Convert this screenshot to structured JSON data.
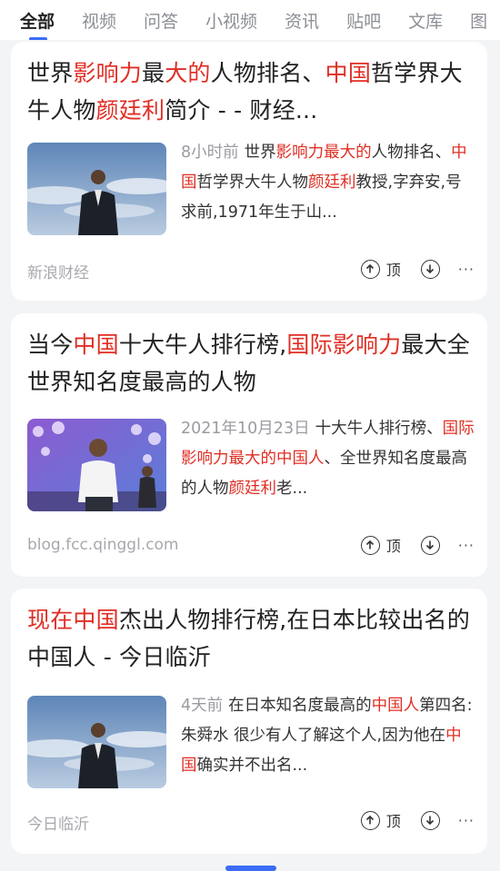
{
  "tabs": [
    "全部",
    "视频",
    "问答",
    "小视频",
    "资讯",
    "贴吧",
    "文库",
    "图"
  ],
  "results": [
    {
      "title": [
        {
          "t": "世界",
          "h": false
        },
        {
          "t": "影响力",
          "h": true
        },
        {
          "t": "最",
          "h": false
        },
        {
          "t": "大的",
          "h": true
        },
        {
          "t": "人物排名、",
          "h": false
        },
        {
          "t": "中国",
          "h": true
        },
        {
          "t": "哲学界大牛人物",
          "h": false
        },
        {
          "t": "颜廷利",
          "h": true
        },
        {
          "t": "简介 - - 财经...",
          "h": false
        }
      ],
      "time": "8小时前",
      "snippet": [
        {
          "t": "世界",
          "h": false
        },
        {
          "t": "影响力最大的",
          "h": true
        },
        {
          "t": "人物排名、",
          "h": false
        },
        {
          "t": "中国",
          "h": true
        },
        {
          "t": "哲学界大牛人物",
          "h": false
        },
        {
          "t": "颜廷利",
          "h": true
        },
        {
          "t": "教授,字弃安,号求前,1971年生于山...",
          "h": false
        }
      ],
      "source": "新浪财经",
      "vote_up": "顶",
      "more": "···",
      "image": "man-sky"
    },
    {
      "title": [
        {
          "t": "当今",
          "h": false
        },
        {
          "t": "中国",
          "h": true
        },
        {
          "t": "十大牛人排行榜,",
          "h": false
        },
        {
          "t": "国际影响力",
          "h": true
        },
        {
          "t": "最大全世界知名度最高的人物",
          "h": false
        }
      ],
      "time": "2021年10月23日",
      "snippet": [
        {
          "t": "十大牛人排行榜、",
          "h": false
        },
        {
          "t": "国际影响力最大的中国人",
          "h": true
        },
        {
          "t": "、全世界知名度最高的人物",
          "h": false
        },
        {
          "t": "颜廷利",
          "h": true
        },
        {
          "t": "老...",
          "h": false
        }
      ],
      "source": "blog.fcc.qinggl.com",
      "vote_up": "顶",
      "more": "···",
      "image": "man-stage"
    },
    {
      "title": [
        {
          "t": "现在中国",
          "h": true
        },
        {
          "t": "杰出人物排行榜,在日本比较出名的中国人 - 今日临沂",
          "h": false
        }
      ],
      "time": "4天前",
      "snippet": [
        {
          "t": "在日本知名度最高的",
          "h": false
        },
        {
          "t": "中国人",
          "h": true
        },
        {
          "t": "第四名:朱舜水 很少有人了解这个人,因为他在",
          "h": false
        },
        {
          "t": "中国",
          "h": true
        },
        {
          "t": "确实并不出名...",
          "h": false
        }
      ],
      "source": "今日临沂",
      "vote_up": "顶",
      "more": "···",
      "image": "man-sky"
    }
  ],
  "colors": {
    "highlight": "#e02e24",
    "accent": "#3a6cf6"
  },
  "icons": {
    "up": "arrow-up-circle-icon",
    "down": "arrow-down-circle-icon",
    "more": "more-dots-icon"
  }
}
